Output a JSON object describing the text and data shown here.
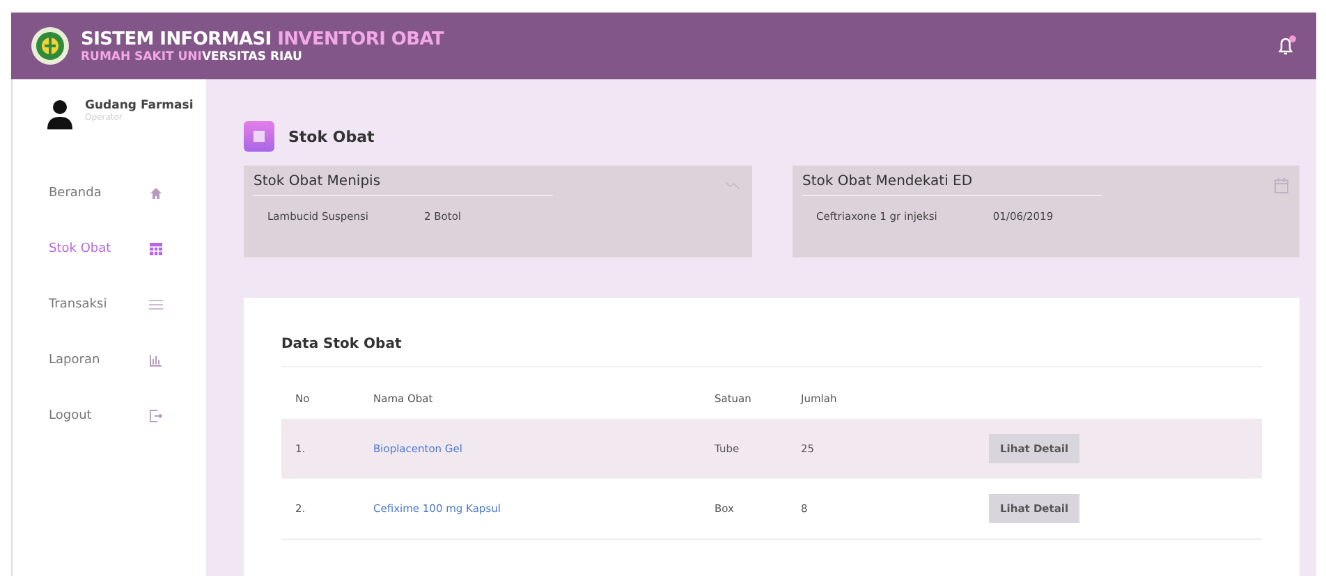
{
  "header": {
    "title_part1": "SISTEM INFORMASI",
    "title_part2": "INVENTORI OBAT",
    "subtitle_part1": "RUMAH SAKIT UNI",
    "subtitle_part2": "VERSITAS RIAU",
    "notification": true
  },
  "sidebar": {
    "user": {
      "name": "Gudang Farmasi",
      "role": "Operator"
    },
    "items": [
      {
        "label": "Beranda",
        "kind": "home",
        "selected": false
      },
      {
        "label": "Stok Obat",
        "kind": "table",
        "selected": true
      },
      {
        "label": "Transaksi",
        "kind": "list",
        "selected": false
      },
      {
        "label": "Laporan",
        "kind": "chart",
        "selected": false
      },
      {
        "label": "Logout",
        "kind": "logout",
        "selected": false
      }
    ]
  },
  "page_title": "Stok Obat",
  "alerts": [
    {
      "title": "Stok Obat Menipis",
      "kind": "trend",
      "item": "Lambucid Suspensi",
      "value": "2 Botol"
    },
    {
      "title": "Stok Obat Mendekati ED",
      "kind": "calendar",
      "item": "Ceftriaxone 1 gr injeksi",
      "value": "01/06/2019"
    }
  ],
  "table": {
    "title": "Data Stok Obat",
    "columns": [
      "No",
      "Nama Obat",
      "Satuan",
      "Jumlah"
    ],
    "rows": [
      {
        "no": "1.",
        "name": "Bioplacenton Gel",
        "unit": "Tube",
        "qty": "25",
        "action": "Lihat Detail"
      },
      {
        "no": "2.",
        "name": "Cefixime 100 mg Kapsul",
        "unit": "Box",
        "qty": "8",
        "action": "Lihat Detail"
      }
    ]
  }
}
